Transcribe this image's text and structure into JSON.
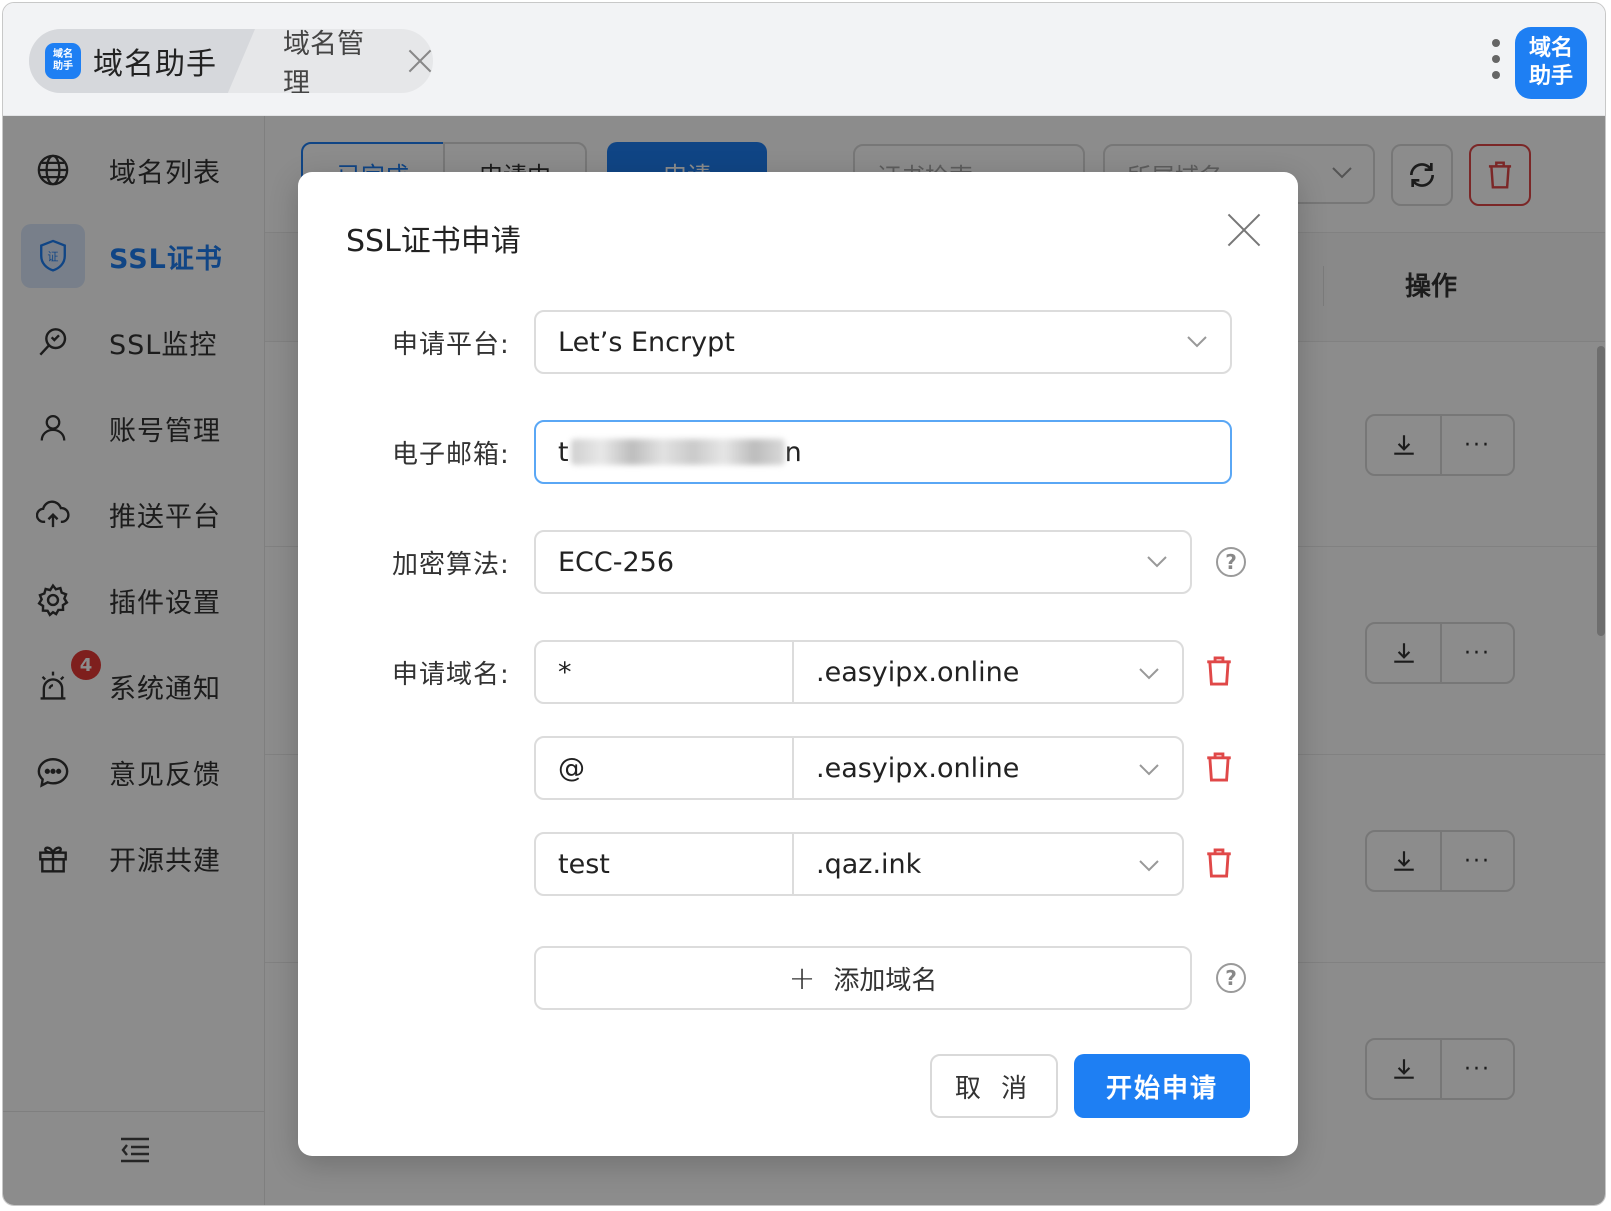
{
  "topbar": {
    "home_tab_label": "域名助手",
    "logo_small_line1": "域名",
    "logo_small_line2": "助手",
    "domain_tab_label": "域名管理",
    "logo_large_line1": "域名",
    "logo_large_line2": "助手"
  },
  "sidebar": {
    "items": [
      {
        "label": "域名列表",
        "icon": "globe-icon"
      },
      {
        "label": "SSL证书",
        "icon": "shield-cert-icon"
      },
      {
        "label": "SSL监控",
        "icon": "magnifier-icon"
      },
      {
        "label": "账号管理",
        "icon": "user-icon"
      },
      {
        "label": "推送平台",
        "icon": "cloud-upload-icon"
      },
      {
        "label": "插件设置",
        "icon": "gear-icon"
      },
      {
        "label": "系统通知",
        "icon": "alarm-icon"
      },
      {
        "label": "意见反馈",
        "icon": "chat-icon"
      },
      {
        "label": "开源共建",
        "icon": "gift-icon"
      }
    ],
    "notification_badge": "4",
    "active_index": 1
  },
  "main": {
    "segment_done": "已完成",
    "segment_applying": "申请中",
    "apply_button": "申请",
    "search_placeholder": "证书检索",
    "domain_filter_placeholder": "所属域名",
    "column_ops": "操作"
  },
  "modal": {
    "title": "SSL证书申请",
    "platform_label": "申请平台:",
    "platform_value": "Let’s Encrypt",
    "email_label": "电子邮箱:",
    "email_value_visible_start": "t",
    "email_value_visible_end": "n",
    "algo_label": "加密算法:",
    "algo_value": "ECC-256",
    "domains_label": "申请域名:",
    "domains": [
      {
        "sub": "*",
        "root": ".easyipx.online"
      },
      {
        "sub": "@",
        "root": ".easyipx.online"
      },
      {
        "sub": "test",
        "root": ".qaz.ink"
      }
    ],
    "add_domain_label": "添加域名",
    "cancel_label": "取 消",
    "submit_label": "开始申请"
  },
  "colors": {
    "accent": "#1e7ff3",
    "danger": "#e04848"
  }
}
